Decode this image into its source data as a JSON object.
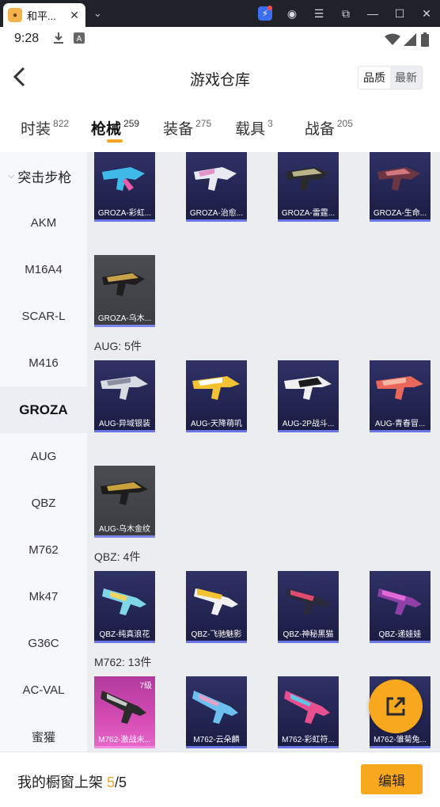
{
  "window": {
    "tab_title": "和平...",
    "close": "✕",
    "chevron": "⌄"
  },
  "status": {
    "time": "9:28"
  },
  "header": {
    "title": "游戏仓库",
    "sort_quality": "品质",
    "sort_newest": "最新"
  },
  "tabs": [
    {
      "label": "时装",
      "count": "822"
    },
    {
      "label": "枪械",
      "count": "259"
    },
    {
      "label": "装备",
      "count": "275"
    },
    {
      "label": "载具",
      "count": "3"
    },
    {
      "label": "战备",
      "count": "205"
    }
  ],
  "sidebar": {
    "group": "突击步枪",
    "items": [
      "AKM",
      "M16A4",
      "SCAR-L",
      "M416",
      "GROZA",
      "AUG",
      "QBZ",
      "M762",
      "Mk47",
      "G36C",
      "AC-VAL",
      "蜜獾"
    ]
  },
  "sections": {
    "groza_row1": [
      "GROZA-彩虹...",
      "GROZA-治愈...",
      "GROZA-雷霆...",
      "GROZA-生命..."
    ],
    "groza_row2": [
      "GROZA-乌木..."
    ],
    "aug_title": "AUG: 5件",
    "aug_row1": [
      "AUG-异域银装",
      "AUG-天降萌叽",
      "AUG-2P战斗...",
      "AUG-青春冒..."
    ],
    "aug_row2": [
      "AUG-乌木金纹"
    ],
    "qbz_title": "QBZ: 4件",
    "qbz_row1": [
      "QBZ-纯真浪花",
      "QBZ-飞驰魅影",
      "QBZ-神秘黑猫",
      "QBZ-递娃娃"
    ],
    "m762_title": "M762: 13件",
    "m762_row1": [
      "M762-激战未...",
      "M762-云朵麟",
      "M762-彩虹符...",
      "M762-雏菊兔..."
    ],
    "m762_level": "7级"
  },
  "bottom": {
    "label": "我的橱窗上架 ",
    "count": "5",
    "total": "/5",
    "edit": "编辑"
  },
  "colors": {
    "accent": "#f7a81c",
    "card_bg": "#2f3266",
    "card_border": "#6b76e6"
  }
}
